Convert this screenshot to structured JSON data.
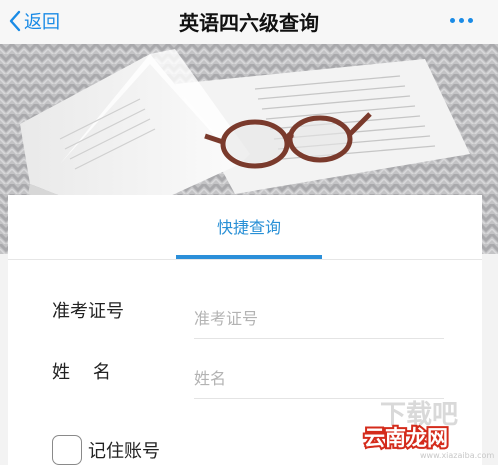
{
  "nav": {
    "back_label": "返回",
    "title": "英语四六级查询",
    "back_icon": "chevron-left-icon",
    "more_icon": "more-dots-icon",
    "accent_color": "#1a8be6"
  },
  "hero": {
    "description_icon": "book-glasses-photo"
  },
  "tabs": [
    {
      "label": "快捷查询",
      "active": true
    }
  ],
  "form": {
    "exam_id": {
      "label": "准考证号",
      "placeholder": "准考证号",
      "value": ""
    },
    "name": {
      "label": "姓    名",
      "placeholder": "姓名",
      "value": ""
    },
    "remember": {
      "label": "记住账号",
      "checked": false
    }
  },
  "watermark": {
    "line1": "下载吧",
    "line2": "云南龙网",
    "line3": "www.xiazaiba.com"
  }
}
